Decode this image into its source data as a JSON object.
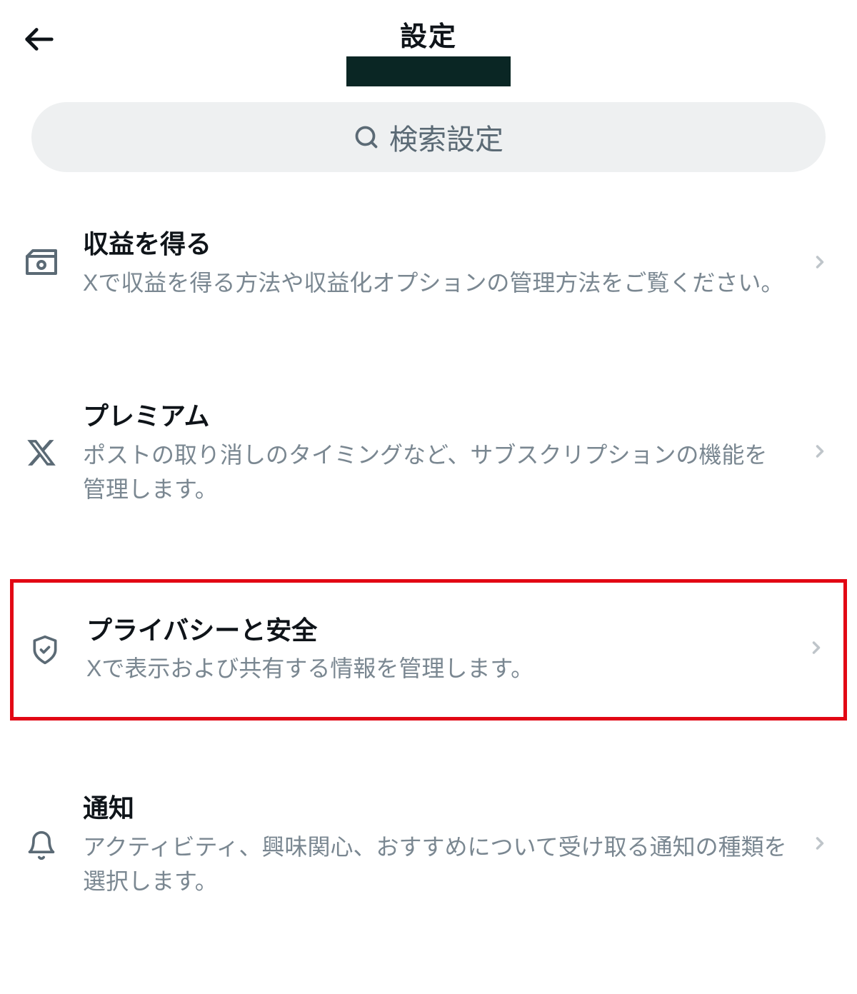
{
  "header": {
    "title": "設定"
  },
  "search": {
    "placeholder": "検索設定"
  },
  "items": [
    {
      "title": "収益を得る",
      "description": "Xで収益を得る方法や収益化オプションの管理方法をご覧ください。"
    },
    {
      "title": "プレミアム",
      "description": "ポストの取り消しのタイミングなど、サブスクリプションの機能を管理します。"
    },
    {
      "title": "プライバシーと安全",
      "description": "Xで表示および共有する情報を管理します。"
    },
    {
      "title": "通知",
      "description": "アクティビティ、興味関心、おすすめについて受け取る通知の種類を選択します。"
    }
  ]
}
